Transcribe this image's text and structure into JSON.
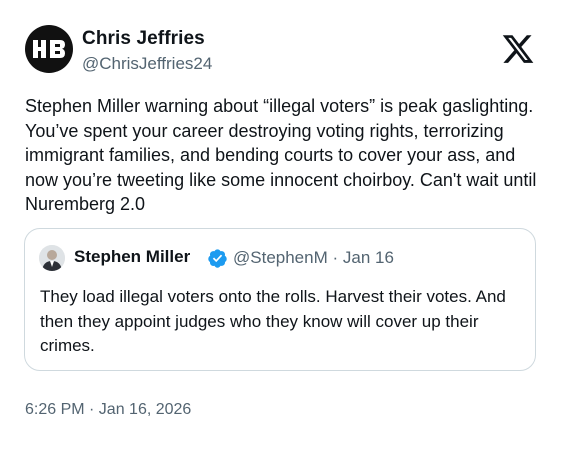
{
  "author": {
    "name": "Chris Jeffries",
    "handle": "@ChrisJeffries24",
    "avatar_text": "HB",
    "avatar_color": "#111111"
  },
  "platform": {
    "logo_icon": "x-logo-icon"
  },
  "tweet": {
    "text": "Stephen Miller warning about “illegal voters” is peak gaslighting. You’ve spent your career destroying voting rights, terrorizing immigrant families, and bending courts to cover your ass, and now you’re tweeting like some innocent choirboy. Can't wait until Nuremberg 2.0",
    "timestamp": "6:26 PM · Jan 16, 2026"
  },
  "quoted_tweet": {
    "name": "Stephen Miller",
    "verified_icon": "verified-badge-icon",
    "verified_color": "#1d9bf0",
    "meta": "@StephenM · Jan 16",
    "text": "They load illegal voters onto the rolls. Harvest their votes. And then they appoint judges who they know will cover up their crimes."
  },
  "colors": {
    "text_primary": "#0f1419",
    "text_secondary": "#536471",
    "border": "#cfd9de"
  }
}
